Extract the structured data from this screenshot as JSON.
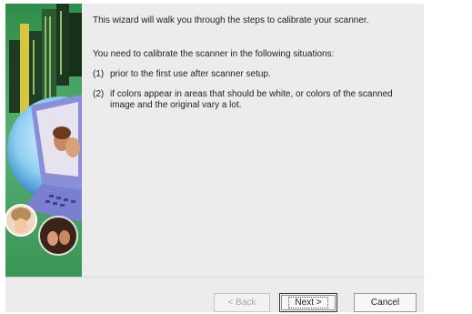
{
  "wizard": {
    "intro": "This wizard will walk you through the steps to calibrate your scanner.",
    "need_heading": "You need to calibrate the scanner in the following situations:",
    "items": [
      {
        "num": "(1)",
        "text": "prior to the first use after scanner setup."
      },
      {
        "num": "(2)",
        "text": "if colors appear in areas that should be white, or colors of the scanned image and the original vary a lot."
      }
    ]
  },
  "buttons": {
    "back": "< Back",
    "next": "Next >",
    "cancel": "Cancel"
  },
  "colors": {
    "sidebar_green": "#3f9a5c",
    "dialog_bg": "#ececec"
  }
}
